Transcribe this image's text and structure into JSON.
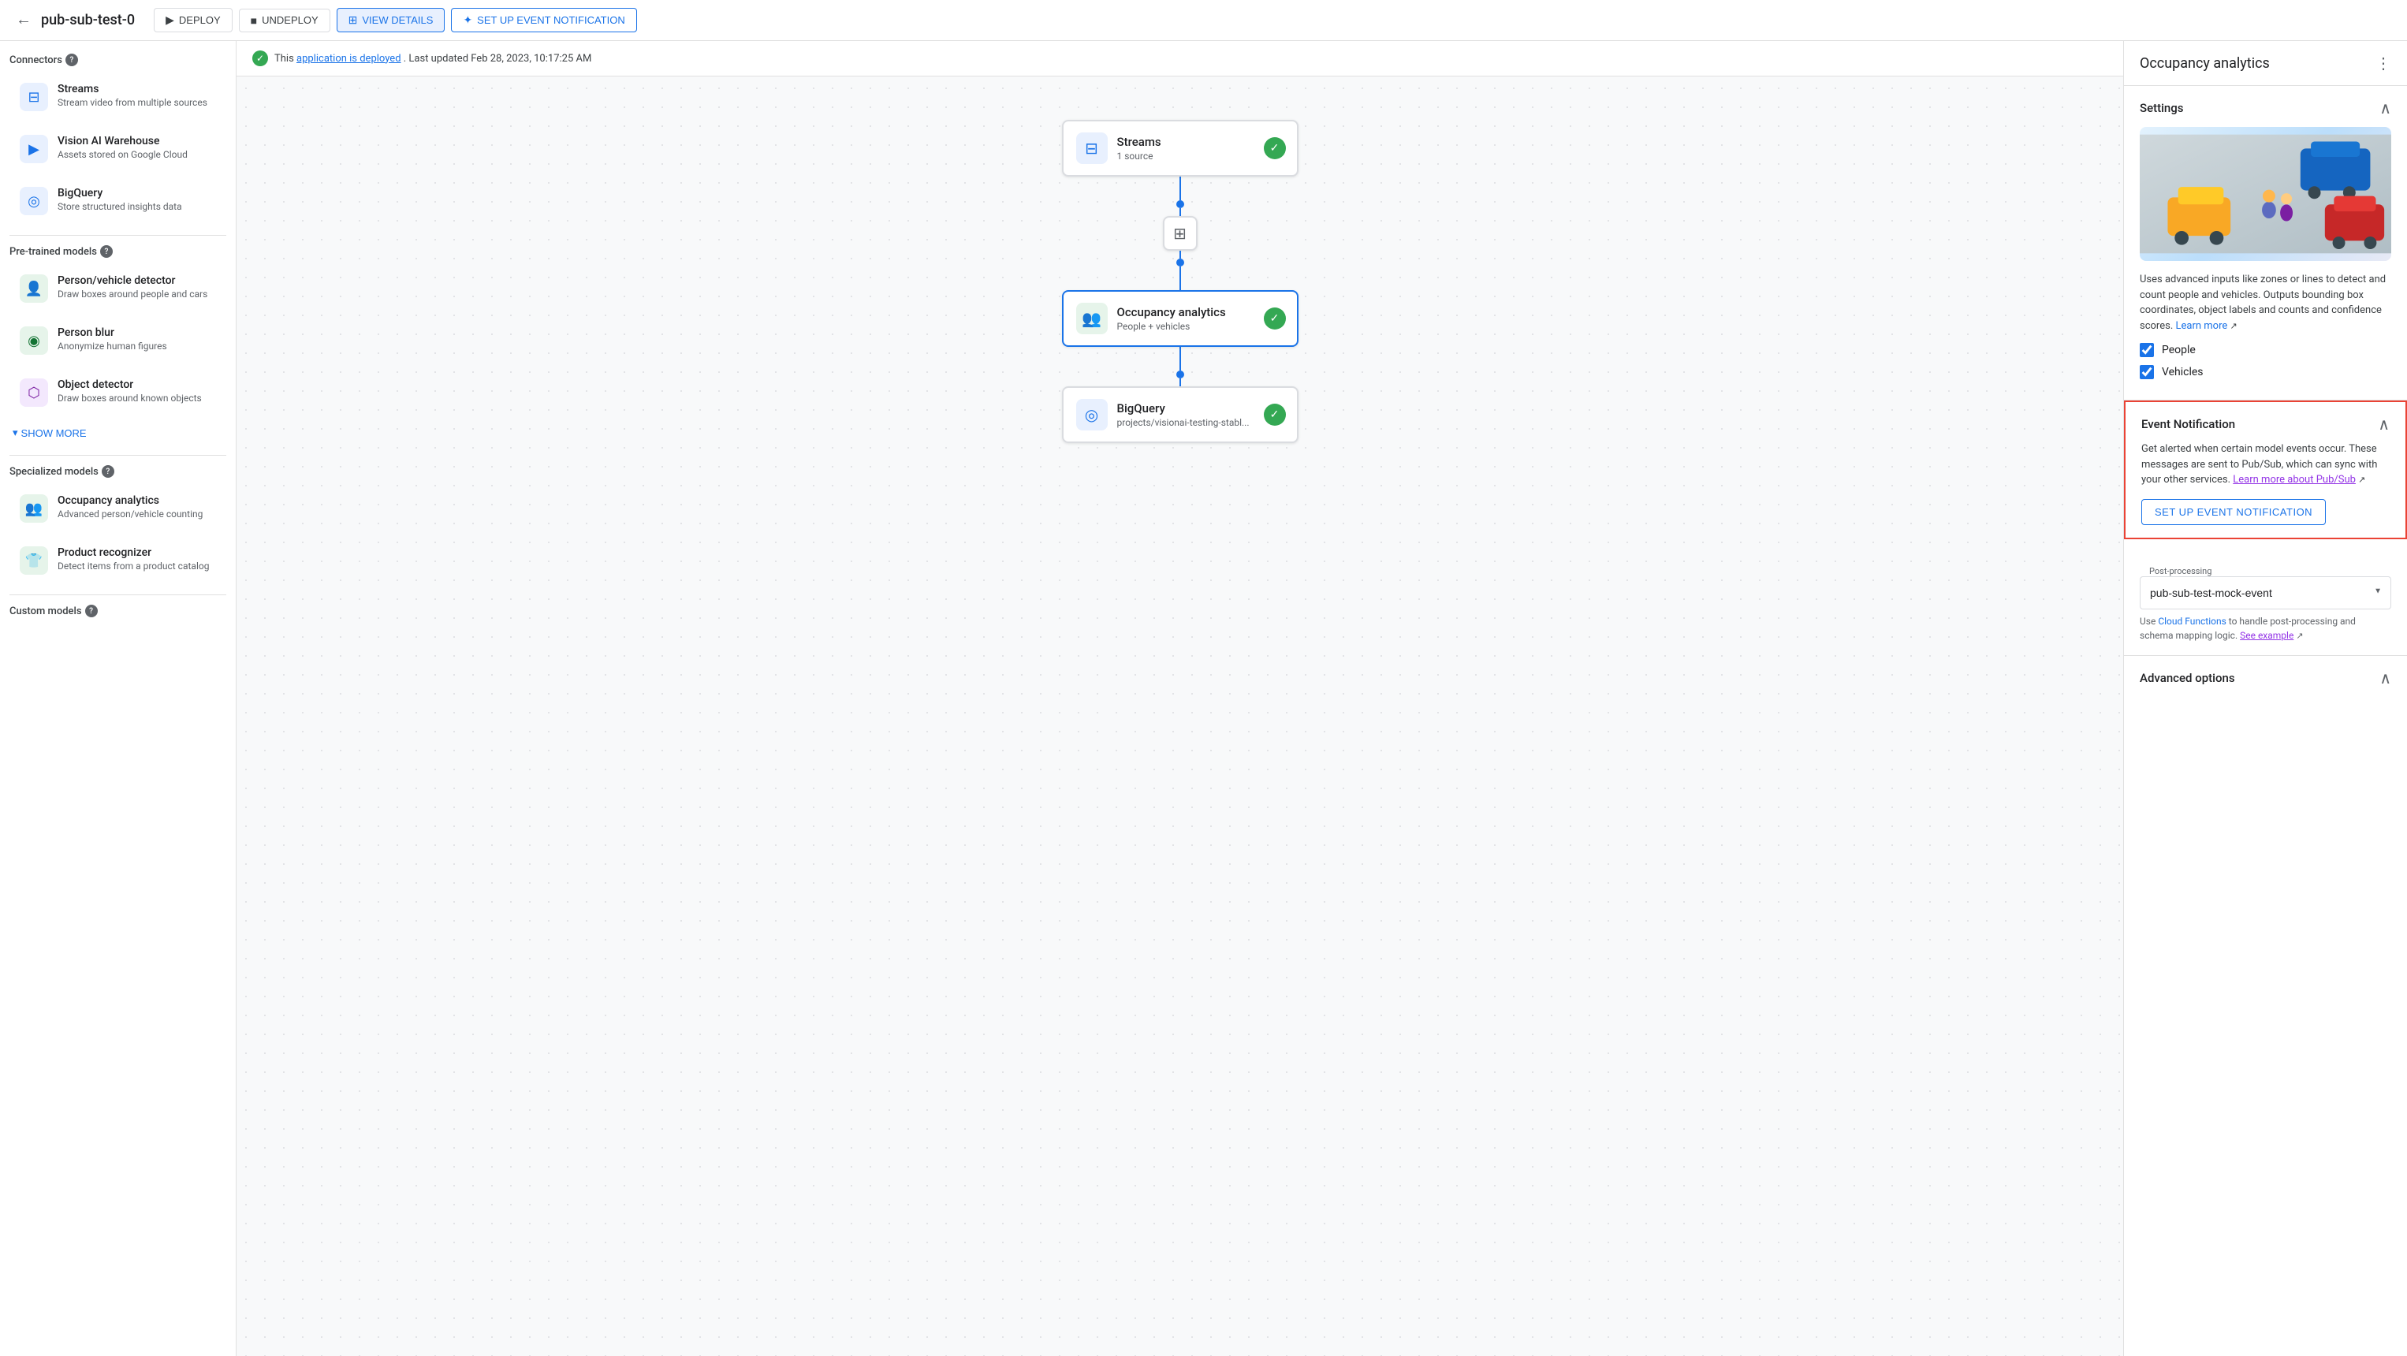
{
  "topNav": {
    "backIcon": "←",
    "appTitle": "pub-sub-test-0",
    "buttons": [
      {
        "label": "DEPLOY",
        "icon": "▶",
        "type": "default",
        "name": "deploy-button"
      },
      {
        "label": "UNDEPLOY",
        "icon": "■",
        "type": "default",
        "name": "undeploy-button"
      },
      {
        "label": "VIEW DETAILS",
        "icon": "⊞",
        "type": "active",
        "name": "view-details-button"
      },
      {
        "label": "SET UP EVENT NOTIFICATION",
        "icon": "✦",
        "type": "primary",
        "name": "setup-event-nav-button"
      }
    ]
  },
  "statusBar": {
    "icon": "✓",
    "preText": "This",
    "linkText": "application is deployed",
    "postText": ". Last updated Feb 28, 2023, 10:17:25 AM"
  },
  "sidebar": {
    "connectorsSectionTitle": "Connectors",
    "connectors": [
      {
        "icon": "⊟",
        "title": "Streams",
        "desc": "Stream video from multiple sources",
        "iconStyle": "blue"
      },
      {
        "icon": "▶",
        "title": "Vision AI Warehouse",
        "desc": "Assets stored on Google Cloud",
        "iconStyle": "blue"
      },
      {
        "icon": "◎",
        "title": "BigQuery",
        "desc": "Store structured insights data",
        "iconStyle": "blue"
      }
    ],
    "preTrainedSectionTitle": "Pre-trained models",
    "preTrainedModels": [
      {
        "icon": "👤",
        "title": "Person/vehicle detector",
        "desc": "Draw boxes around people and cars",
        "iconStyle": "teal"
      },
      {
        "icon": "◉",
        "title": "Person blur",
        "desc": "Anonymize human figures",
        "iconStyle": "teal"
      },
      {
        "icon": "⬡",
        "title": "Object detector",
        "desc": "Draw boxes around known objects",
        "iconStyle": "purple"
      }
    ],
    "showMoreLabel": "SHOW MORE",
    "specializedSectionTitle": "Specialized models",
    "specializedModels": [
      {
        "icon": "👥",
        "title": "Occupancy analytics",
        "desc": "Advanced person/vehicle counting",
        "iconStyle": "teal"
      },
      {
        "icon": "👕",
        "title": "Product recognizer",
        "desc": "Detect items from a product catalog",
        "iconStyle": "teal"
      }
    ],
    "customModelsSectionTitle": "Custom models"
  },
  "pipeline": {
    "nodes": [
      {
        "id": "streams",
        "icon": "⊟",
        "title": "Streams",
        "sub": "1 source",
        "iconStyle": "blue",
        "checked": true
      },
      {
        "id": "middle",
        "icon": "⊞"
      },
      {
        "id": "occupancy",
        "icon": "👥",
        "title": "Occupancy analytics",
        "sub": "People + vehicles",
        "iconStyle": "teal",
        "checked": true,
        "selected": true
      },
      {
        "id": "bigquery",
        "icon": "◎",
        "title": "BigQuery",
        "sub": "projects/visionai-testing-stabl...",
        "iconStyle": "blue",
        "checked": true
      }
    ]
  },
  "rightPanel": {
    "title": "Occupancy analytics",
    "moreIcon": "⋮",
    "settings": {
      "sectionTitle": "Settings",
      "description": "Uses advanced inputs like zones or lines to detect and count people and vehicles. Outputs bounding box coordinates, object labels and counts and confidence scores.",
      "learnMoreText": "Learn more",
      "checkboxes": [
        {
          "label": "People",
          "checked": true
        },
        {
          "label": "Vehicles",
          "checked": true
        }
      ]
    },
    "eventNotification": {
      "sectionTitle": "Event Notification",
      "description": "Get alerted when certain model events occur. These messages are sent to Pub/Sub, which can sync with your other services.",
      "pubsubLinkText": "Learn more about Pub/Sub",
      "buttonLabel": "SET UP EVENT NOTIFICATION"
    },
    "postProcessing": {
      "fieldLabel": "Post-processing",
      "selectValue": "pub-sub-test-mock-event",
      "helperText": "Use Cloud Functions to handle post-processing and schema mapping logic.",
      "seeExampleText": "See example"
    },
    "advancedOptions": {
      "sectionTitle": "Advanced options"
    }
  }
}
